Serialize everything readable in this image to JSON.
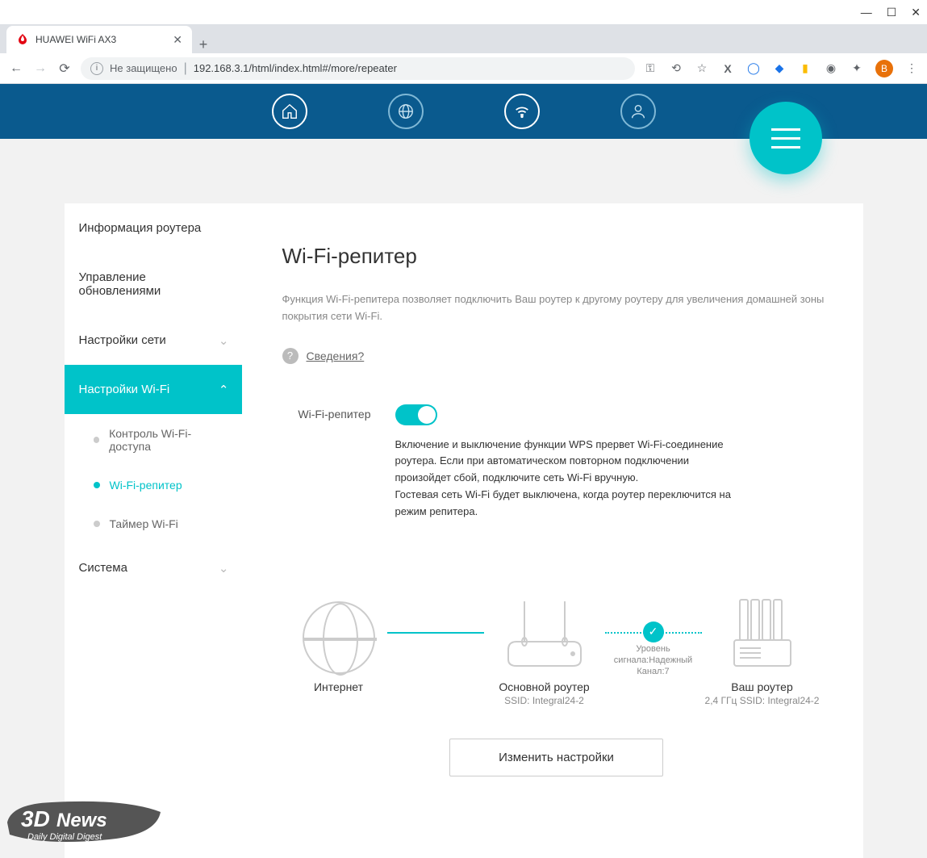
{
  "browser": {
    "tab_title": "HUAWEI WiFi AX3",
    "secure_label": "Не защищено",
    "url": "192.168.3.1/html/index.html#/more/repeater",
    "user_badge": "B"
  },
  "sidebar": {
    "items": [
      {
        "label": "Информация роутера"
      },
      {
        "label": "Управление обновлениями"
      },
      {
        "label": "Настройки сети",
        "chev": "⌄"
      },
      {
        "label": "Настройки Wi-Fi",
        "chev": "⌃",
        "active": true
      },
      {
        "label": "Контроль Wi-Fi-доступа",
        "sub": true
      },
      {
        "label": "Wi-Fi-репитер",
        "sub": true,
        "active": true
      },
      {
        "label": "Таймер Wi-Fi",
        "sub": true
      },
      {
        "label": "Система",
        "chev": "⌄"
      }
    ]
  },
  "page": {
    "title": "Wi-Fi-репитер",
    "description": "Функция Wi-Fi-репитера позволяет подключить Ваш роутер к другому роутеру для увеличения домашней зоны покрытия сети Wi-Fi.",
    "details_link": "Сведения?",
    "toggle_label": "Wi-Fi-репитер",
    "toggle_desc_1": "Включение и выключение функции WPS прервет Wi-Fi-соединение роутера. Если при автоматическом повторном подключении произойдет сбой, подключите сеть Wi-Fi вручную.",
    "toggle_desc_2": "Гостевая сеть Wi-Fi будет выключена, когда роутер переключится на режим репитера.",
    "save_button": "Изменить настройки"
  },
  "diagram": {
    "internet": {
      "label": "Интернет"
    },
    "main_router": {
      "label": "Основной роутер",
      "sub": "SSID: Integral24-2"
    },
    "link": {
      "signal": "Уровень сигнала:Надежный",
      "channel": "Канал:7"
    },
    "your_router": {
      "label": "Ваш роутер",
      "sub": "2,4 ГГц SSID: Integral24-2"
    }
  },
  "watermark": {
    "brand": "3DNews",
    "tagline": "Daily Digital Digest"
  }
}
